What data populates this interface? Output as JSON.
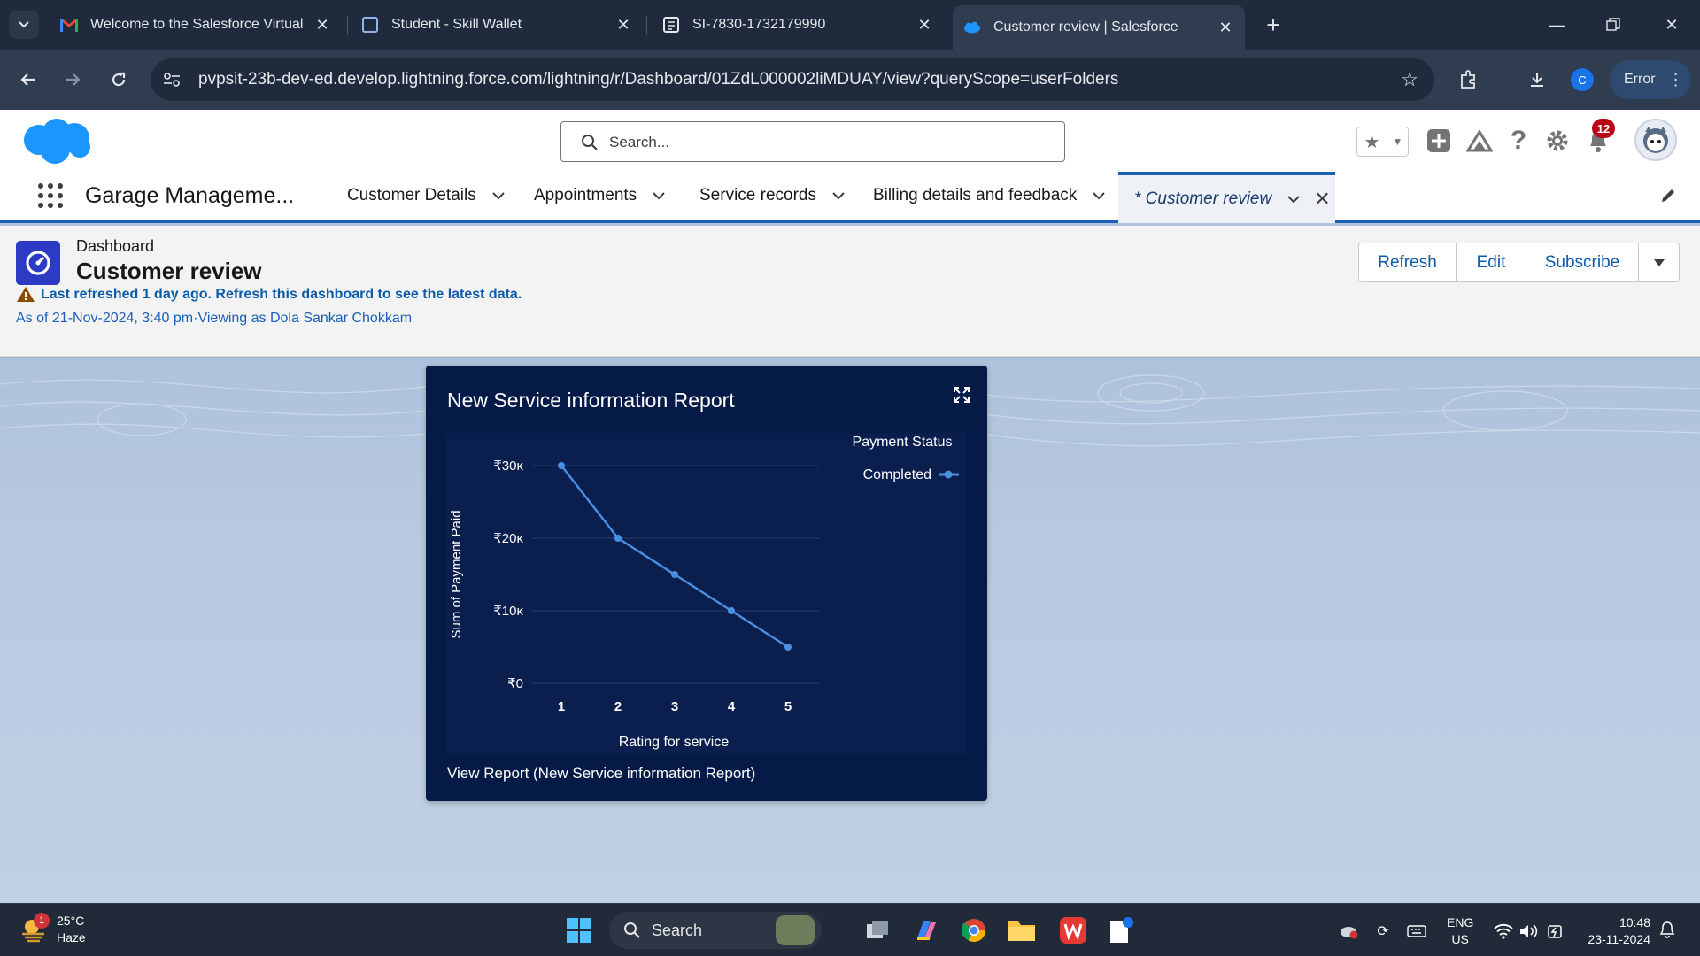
{
  "browser": {
    "tabs": [
      {
        "title": "Welcome to the Salesforce Virtual",
        "icon": "gmail-icon"
      },
      {
        "title": "Student - Skill Wallet",
        "icon": "skillwallet-icon"
      },
      {
        "title": "SI-7830-1732179990",
        "icon": "document-icon"
      },
      {
        "title": "Customer review | Salesforce",
        "icon": "salesforce-cloud-icon",
        "active": true
      }
    ],
    "url": "pvpsit-23b-dev-ed.develop.lightning.force.com/lightning/r/Dashboard/01ZdL000002liMDUAY/view?queryScope=userFolders",
    "profile_initial": "C",
    "error_label": "Error"
  },
  "salesforce": {
    "search_placeholder": "Search...",
    "notification_count": "12",
    "app_name": "Garage Manageme...",
    "nav_items": [
      {
        "label": "Customer Details"
      },
      {
        "label": "Appointments"
      },
      {
        "label": "Service records"
      },
      {
        "label": "Billing details and feedback"
      }
    ],
    "active_tab": "* Customer review"
  },
  "page_header": {
    "object_type": "Dashboard",
    "title": "Customer review",
    "warning": "Last refreshed 1 day ago. Refresh this dashboard to see the latest data.",
    "as_of": "As of 21-Nov-2024, 3:40 pm·Viewing as Dola Sankar Chokkam",
    "buttons": {
      "refresh": "Refresh",
      "edit": "Edit",
      "subscribe": "Subscribe"
    }
  },
  "widget": {
    "title": "New Service information Report",
    "footer_link": "View Report (New Service information Report)"
  },
  "chart_data": {
    "type": "line",
    "title": "",
    "xlabel": "Rating for service",
    "ylabel": "Sum of Payment Paid",
    "x": [
      1,
      2,
      3,
      4,
      5
    ],
    "series": [
      {
        "name": "Completed",
        "values": [
          30000,
          20000,
          15000,
          10000,
          5000
        ]
      }
    ],
    "ylim": [
      0,
      30000
    ],
    "yticks": [
      {
        "value": 30000,
        "label": "₹30ĸ"
      },
      {
        "value": 20000,
        "label": "₹20ĸ"
      },
      {
        "value": 10000,
        "label": "₹10ĸ"
      },
      {
        "value": 0,
        "label": "₹0"
      }
    ],
    "legend_title": "Payment Status",
    "legend_position": "top-right",
    "grid": true,
    "colors": {
      "line": "#4a90e2",
      "background": "#0b1f4f",
      "grid": "#2a3d6b",
      "text": "#ffffff"
    }
  },
  "taskbar": {
    "weather_temp": "25°C",
    "weather_desc": "Haze",
    "weather_badge": "1",
    "search_label": "Search",
    "lang_top": "ENG",
    "lang_bottom": "US",
    "time": "10:48",
    "date": "23-11-2024"
  },
  "colors": {
    "brand_blue": "#0b5cab",
    "nav_accent": "#1b5fb8",
    "widget_bg": "#051a47",
    "badge_red": "#ba0517",
    "dashboard_icon": "#2c3ac4"
  }
}
